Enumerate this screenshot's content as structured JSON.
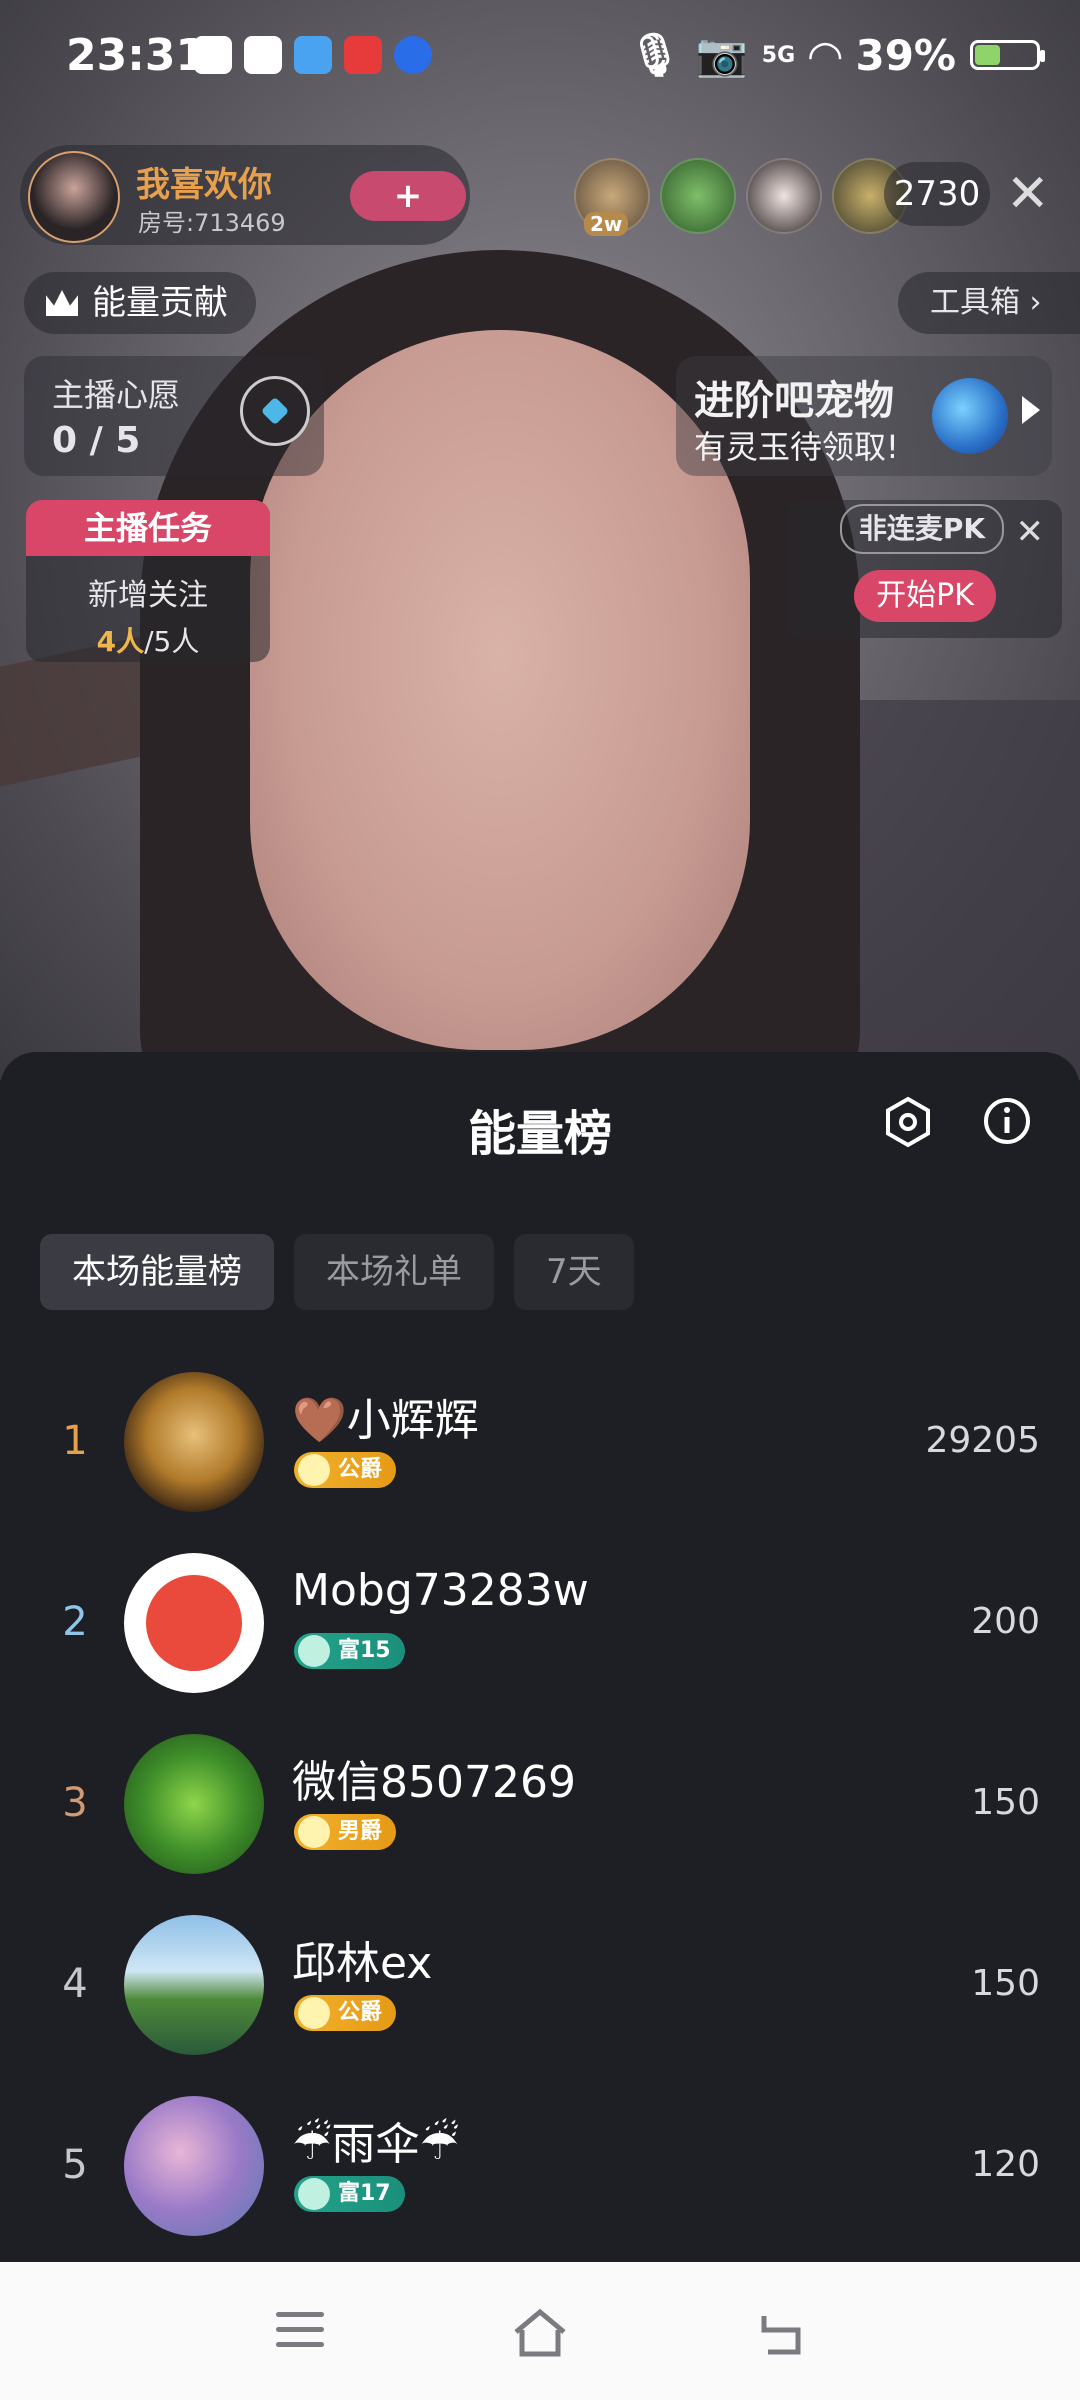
{
  "status_bar": {
    "time": "23:31",
    "network": "5G",
    "battery": "39%",
    "battery_level": 0.39
  },
  "host": {
    "name": "我喜欢你",
    "room": "房号:713469",
    "follow": "+"
  },
  "viewer_count": "2730",
  "viewers_badge": "2w",
  "energy_label": "能量贡献",
  "toolbox_label": "工具箱",
  "wish": {
    "title": "主播心愿",
    "value": "0 / 5"
  },
  "pet": {
    "title": "进阶吧宠物",
    "subtitle": "有灵玉待领取!"
  },
  "task": {
    "header": "主播任务",
    "line1": "新增关注",
    "done": "4人",
    "total": "/5人"
  },
  "pk": {
    "label": "非连麦PK",
    "button": "开始PK"
  },
  "sheet": {
    "title": "能量榜",
    "tabs": [
      "本场能量榜",
      "本场礼单",
      "7天"
    ]
  },
  "ranking": [
    {
      "rank": "1",
      "name": "🤎小辉辉",
      "badge": "公爵",
      "score": "29205",
      "rank_color": "#e8a14a"
    },
    {
      "rank": "2",
      "name": "Mobg73283w",
      "badge": "富15",
      "score": "200",
      "rank_color": "#8fc6e8"
    },
    {
      "rank": "3",
      "name": "微信8507269",
      "badge": "男爵",
      "score": "150",
      "rank_color": "#d49a72"
    },
    {
      "rank": "4",
      "name": "邱林ex",
      "badge": "公爵",
      "score": "150",
      "rank_color": "#c8c8cc"
    },
    {
      "rank": "5",
      "name": "☔雨伞☔",
      "badge": "富17",
      "score": "120",
      "rank_color": "#c8c8cc"
    }
  ]
}
